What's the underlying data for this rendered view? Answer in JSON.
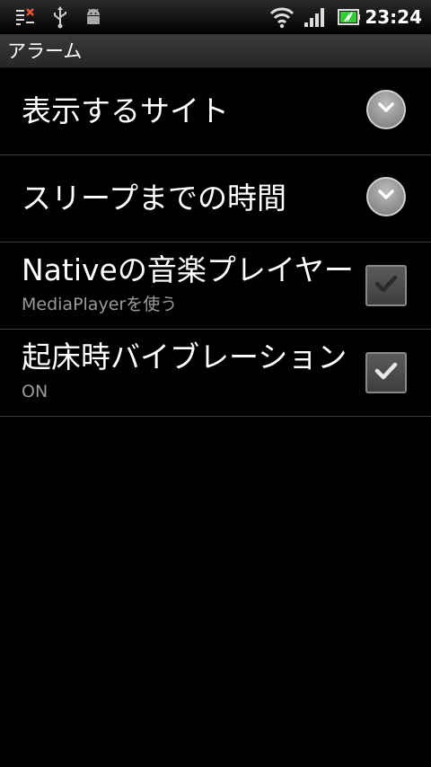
{
  "statusbar": {
    "time": "23:24",
    "icons": [
      "notification-clear-icon",
      "usb-icon",
      "android-debug-icon",
      "wifi-icon",
      "signal-icon",
      "battery-icon"
    ]
  },
  "titlebar": {
    "title": "アラーム"
  },
  "preferences": [
    {
      "title": "表示するサイト",
      "summary": "",
      "control": "dropdown"
    },
    {
      "title": "スリープまでの時間",
      "summary": "",
      "control": "dropdown"
    },
    {
      "title": "Nativeの音楽プレイヤーを",
      "summary": "MediaPlayerを使う",
      "control": "checkbox",
      "checked": false
    },
    {
      "title": "起床時バイブレーション",
      "summary": "ON",
      "control": "checkbox",
      "checked": true
    }
  ],
  "colors": {
    "background": "#000000",
    "summary_text": "#9a9a9a",
    "divider": "#3a3a3a",
    "check_on": "#e8e8e8",
    "check_off": "#2a2a2a"
  }
}
